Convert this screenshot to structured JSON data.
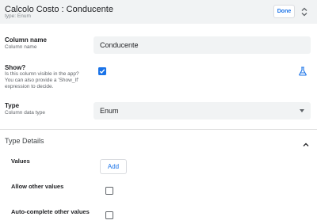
{
  "header": {
    "title": "Calcolo Costo : Conducente",
    "subtitle": "type: Enum",
    "done_label": "Done"
  },
  "column_name": {
    "label": "Column name",
    "help": "Column name",
    "value": "Conducente"
  },
  "show": {
    "label": "Show?",
    "help_lines": [
      "Is this column visible in the app?",
      "You can also provide a 'Show_If'",
      "expression to decide."
    ],
    "checked": true
  },
  "type": {
    "label": "Type",
    "help": "Column data type",
    "selected": "Enum"
  },
  "type_details": {
    "title": "Type Details",
    "values_label": "Values",
    "add_label": "Add",
    "allow_other_label": "Allow other values",
    "allow_other_checked": false,
    "autocomplete_label": "Auto-complete other values",
    "autocomplete_checked": false
  },
  "icons": {
    "expand": "unfold-more-icon",
    "check": "check-icon",
    "flask": "flask-icon",
    "dropdown": "caret-down-icon",
    "collapse": "chevron-up-icon"
  },
  "colors": {
    "accent": "#1a73e8",
    "header_bg": "#f1f3f4",
    "field_bg": "#f1f3f4"
  }
}
